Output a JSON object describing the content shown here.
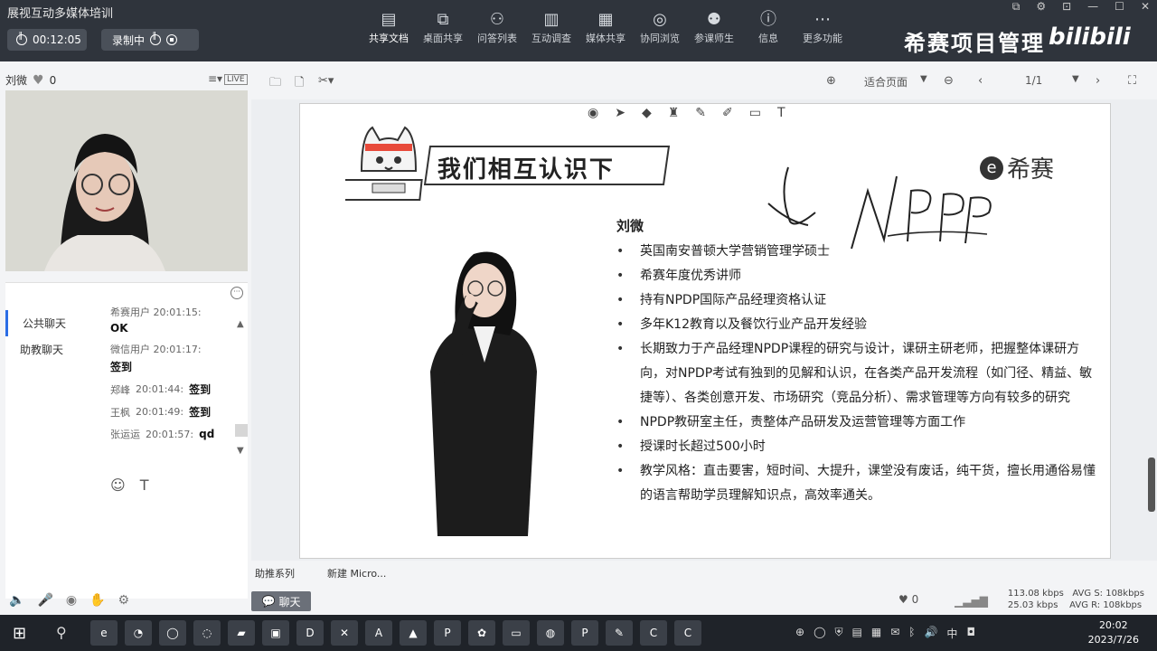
{
  "app": {
    "title": "展视互动多媒体培训",
    "timer": "00:12:05",
    "recording_label": "录制中",
    "brand": "希赛项目管理",
    "bili_logo": "bilibili"
  },
  "toolbar": [
    {
      "label": "共享文档",
      "icon": "doc-icon",
      "glyph": "▤"
    },
    {
      "label": "桌面共享",
      "icon": "desktop-share-icon",
      "glyph": "⧉"
    },
    {
      "label": "问答列表",
      "icon": "qa-icon",
      "glyph": "⚇"
    },
    {
      "label": "互动调查",
      "icon": "survey-icon",
      "glyph": "▥"
    },
    {
      "label": "媒体共享",
      "icon": "media-icon",
      "glyph": "▦"
    },
    {
      "label": "协同浏览",
      "icon": "browse-icon",
      "glyph": "◎"
    },
    {
      "label": "参课师生",
      "icon": "users-icon",
      "glyph": "⚉"
    },
    {
      "label": "信息",
      "icon": "info-icon",
      "glyph": "ⓘ"
    },
    {
      "label": "更多功能",
      "icon": "more-icon",
      "glyph": "⋯"
    }
  ],
  "presenter": {
    "name": "刘微",
    "likes": "0",
    "live_badge": "LIVE"
  },
  "chat": {
    "tabs": [
      "公共聊天",
      "助教聊天"
    ],
    "messages": [
      {
        "user": "希赛用户",
        "time": "20:01:15:",
        "text": "OK"
      },
      {
        "user": "微信用户",
        "time": "20:01:17:",
        "text": "签到"
      },
      {
        "user": "郑峰",
        "time": "20:01:44:",
        "text": "签到"
      },
      {
        "user": "王枫",
        "time": "20:01:49:",
        "text": "签到"
      },
      {
        "user": "张运运",
        "time": "20:01:57:",
        "text": "qd"
      }
    ],
    "chat_button": "聊天"
  },
  "doc_toolbar": {
    "zoom": "适合页面",
    "page": "1/1"
  },
  "slide": {
    "title": "我们相互认识下",
    "logo_text": "希赛",
    "name": "刘微",
    "bullets": [
      "英国南安普顿大学营销管理学硕士",
      "希赛年度优秀讲师",
      "持有NPDP国际产品经理资格认证",
      "多年K12教育以及餐饮行业产品开发经验",
      "长期致力于产品经理NPDP课程的研究与设计，课研主研老师，把握整体课研方向，对NPDP考试有独到的见解和认识，在各类产品开发流程（如门径、精益、敏捷等）、各类创意开发、市场研究（竞品分析）、需求管理等方向有较多的研究",
      "NPDP教研室主任，责整体产品研发及运营管理等方面工作",
      "授课时长超过500小时",
      "教学风格：直击要害，短时间、大提升，课堂没有废话，纯干货，擅长用通俗易懂的语言帮助学员理解知识点，高效率通关。"
    ]
  },
  "bottom": {
    "doc_tabs": [
      "助推系列",
      "新建 Micro..."
    ],
    "likes": "0",
    "up_rate": "113.08 kbps",
    "down_rate": "25.03 kbps",
    "avg_s": "AVG S: 108kbps",
    "avg_r": "AVG R: 108kbps"
  },
  "taskbar": {
    "time": "20:02",
    "date": "2023/7/26",
    "ime": "中"
  }
}
